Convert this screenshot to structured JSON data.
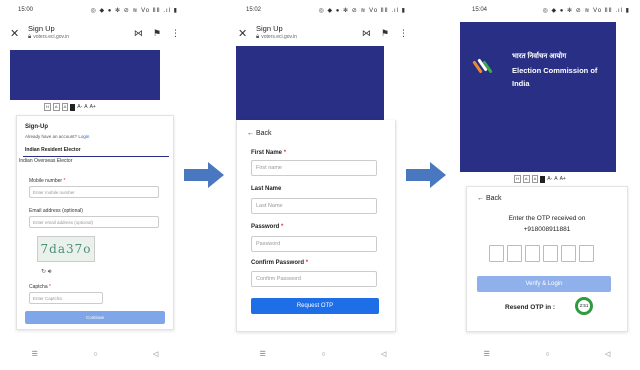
{
  "colors": {
    "banner": "#2a2f86",
    "primary_button": "#1e6ee8",
    "disabled_button": "#7fa6e8",
    "arrow": "#4a78c0",
    "timer_ring": "#2e9b3e"
  },
  "phone1": {
    "status": {
      "time": "15:00",
      "icons": "◎ ◆ ● ✻   ⊘ ≋ Vo ⅡⅡ .ıl ▮"
    },
    "browser": {
      "title": "Sign Up",
      "url": "voters.eci.gov.in"
    },
    "fontbar": {
      "hc": "H",
      "a1": "A",
      "a2": "A",
      "a_minus": "A-",
      "a": "A",
      "a_plus": "A+"
    },
    "form": {
      "heading": "Sign-Up",
      "account_text": "Already have an account?",
      "login_link": "Login",
      "tab_resident": "Indian Resident Elector",
      "tab_overseas": "Indian Overseas Elector",
      "mobile_label": "Mobile number",
      "mobile_placeholder": "Enter mobile number",
      "email_label": "Email address (optional)",
      "email_placeholder": "Enter email address (optional)",
      "captcha_image_text": "7da37o",
      "captcha_label": "Captcha",
      "captcha_placeholder": "Enter Captcha",
      "continue_button": "Continue"
    }
  },
  "phone2": {
    "status": {
      "time": "15:02",
      "icons": "◎ ◆ ● ✻   ⊘ ≋ Vo ⅡⅡ .ıl ▮"
    },
    "browser": {
      "title": "Sign Up",
      "url": "voters.eci.gov.in"
    },
    "form": {
      "back": "Back",
      "first_name_label": "First Name",
      "first_name_placeholder": "First name",
      "last_name_label": "Last Name",
      "last_name_placeholder": "Last Name",
      "password_label": "Password",
      "password_placeholder": "Password",
      "confirm_label": "Confirm Password",
      "confirm_placeholder": "Confirm Password",
      "request_button": "Request OTP"
    }
  },
  "phone3": {
    "status": {
      "time": "15:04",
      "icons": "◎ ◆ ● ✻   ⊘ ≋ Vo ⅡⅡ .ıl ▮"
    },
    "banner": {
      "hindi": "भारत निर्वाचन आयोग",
      "english": "Election Commission of India"
    },
    "fontbar": {
      "hc": "H",
      "a1": "A",
      "a2": "A",
      "a_minus": "A-",
      "a": "A",
      "a_plus": "A+"
    },
    "otp": {
      "back": "Back",
      "message": "Enter the OTP received on",
      "phone": "+918008911881",
      "verify_button": "Verify & Login",
      "resend_label": "Resend OTP in :",
      "timer": "2:51"
    }
  },
  "navbar": {
    "recent": "☰",
    "home": "○",
    "back": "◁"
  }
}
